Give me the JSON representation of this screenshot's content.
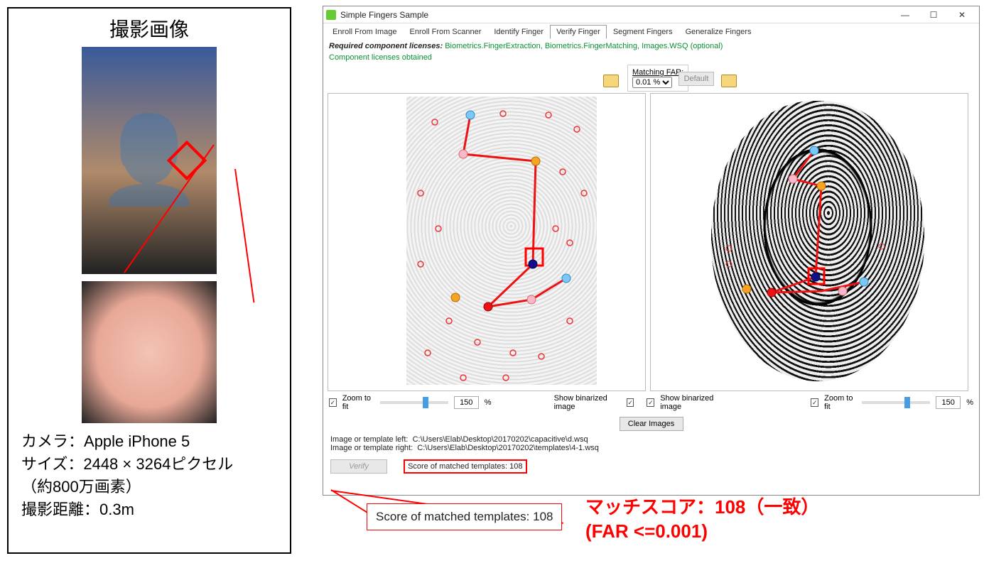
{
  "left": {
    "title": "撮影画像",
    "camera_label": "カメラ：",
    "camera_value": "Apple iPhone 5",
    "size_label": "サイズ：",
    "size_value": "2448 × 3264ピクセル",
    "pixels_note": "（約800万画素）",
    "distance_label": "撮影距離：",
    "distance_value": "0.3m"
  },
  "app": {
    "title": "Simple Fingers Sample",
    "tabs": [
      "Enroll From Image",
      "Enroll From Scanner",
      "Identify Finger",
      "Verify Finger",
      "Segment Fingers",
      "Generalize Fingers"
    ],
    "active_tab": 3,
    "license_label": "Required component licenses:",
    "license_links": "Biometrics.FingerExtraction, Biometrics.FingerMatching, Images.WSQ (optional)",
    "license_status": "Component licenses obtained",
    "matching_far_label": "Matching FAR:",
    "matching_far_value": "0.01 %",
    "default_label": "Default",
    "zoom_to_fit": "Zoom to fit",
    "zoom_left_value": "150",
    "zoom_right_value": "150",
    "percent": "%",
    "show_binarized": "Show binarized image",
    "clear_images": "Clear Images",
    "path_left_label": "Image or template left:",
    "path_left_value": "C:\\Users\\Elab\\Desktop\\20170202\\capacitive\\d.wsq",
    "path_right_label": "Image or template right:",
    "path_right_value": "C:\\Users\\Elab\\Desktop\\20170202\\templates\\4-1.wsq",
    "verify_label": "Verify",
    "score_text": "Score of matched templates: 108"
  },
  "callout": {
    "text": "Score of matched templates: 108"
  },
  "annotation": {
    "line1": "マッチスコア：108（一致）",
    "line2": "(FAR <=0.001)"
  }
}
